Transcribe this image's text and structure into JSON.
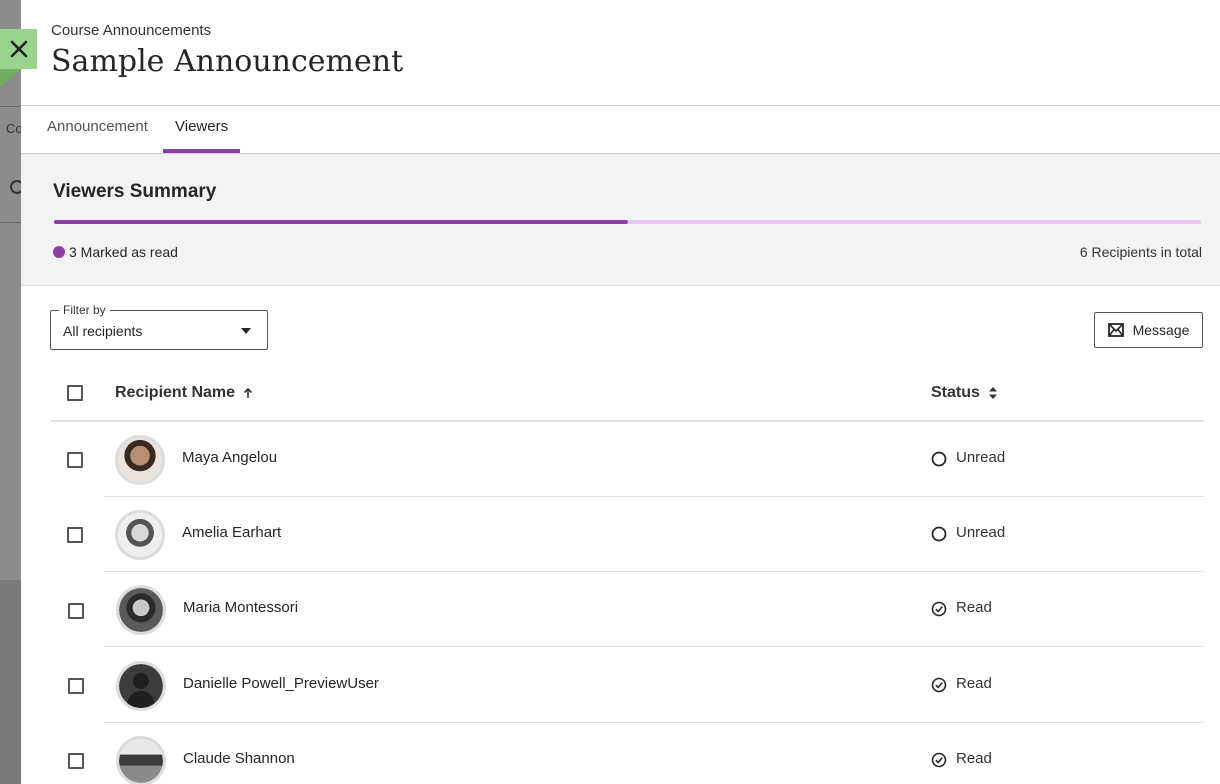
{
  "header": {
    "breadcrumb": "Course Announcements",
    "title": "Sample Announcement"
  },
  "tabs": [
    {
      "label": "Announcement",
      "active": false
    },
    {
      "label": "Viewers",
      "active": true
    }
  ],
  "summary": {
    "title": "Viewers Summary",
    "read_count_label": "3 Marked as read",
    "total_label": "6 Recipients in total",
    "read_fraction": 0.5
  },
  "filter": {
    "legend": "Filter by",
    "value": "All recipients"
  },
  "message_button": {
    "label": "Message"
  },
  "table": {
    "columns": {
      "name": "Recipient Name",
      "status": "Status"
    },
    "rows": [
      {
        "name": "Maya Angelou",
        "status": "Unread"
      },
      {
        "name": "Amelia Earhart",
        "status": "Unread"
      },
      {
        "name": "Maria Montessori",
        "status": "Read"
      },
      {
        "name": "Danielle Powell_PreviewUser",
        "status": "Read"
      },
      {
        "name": "Claude Shannon",
        "status": "Read"
      }
    ]
  },
  "background": {
    "fragment": "Co"
  },
  "colors": {
    "accent": "#8f3ea8",
    "accent_light": "#e6c6ee",
    "close_button": "#9ad38e"
  }
}
